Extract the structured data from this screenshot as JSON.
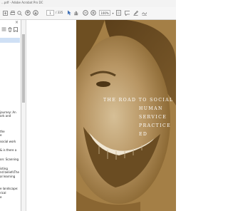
{
  "window": {
    "title": "...pdf - Adobe Acrobat Pro DC"
  },
  "toolbar": {
    "page_current": "1",
    "page_total": "/ 335",
    "zoom": "100%",
    "icons": [
      "add-icon",
      "print-icon",
      "zoom-out-icon",
      "zoom-in-icon",
      "prev-page-icon",
      "next-page-icon",
      "select-pointer-icon",
      "hand-tool-icon",
      "zoom-out-icon",
      "zoom-in-icon",
      "fit-page-icon",
      "comment-icon",
      "highlight-icon",
      "sign-icon"
    ]
  },
  "sidebar": {
    "close_glyph": "×",
    "bookmarks": [
      "journey: An",
      "ork and",
      "the",
      "e",
      "social work",
      "& is there a",
      "on: Scanning",
      "isting",
      "nd beliefsThe",
      "al learning",
      "e landscape:",
      "rical",
      "e"
    ]
  },
  "cover": {
    "title_lines": [
      "THE ROAD TO SOCIAL",
      "HUMAN",
      "SERVICE",
      "PRACTICE",
      "ED"
    ],
    "colors": {
      "sepia": "#a47f46",
      "text": "#ffffff"
    }
  }
}
